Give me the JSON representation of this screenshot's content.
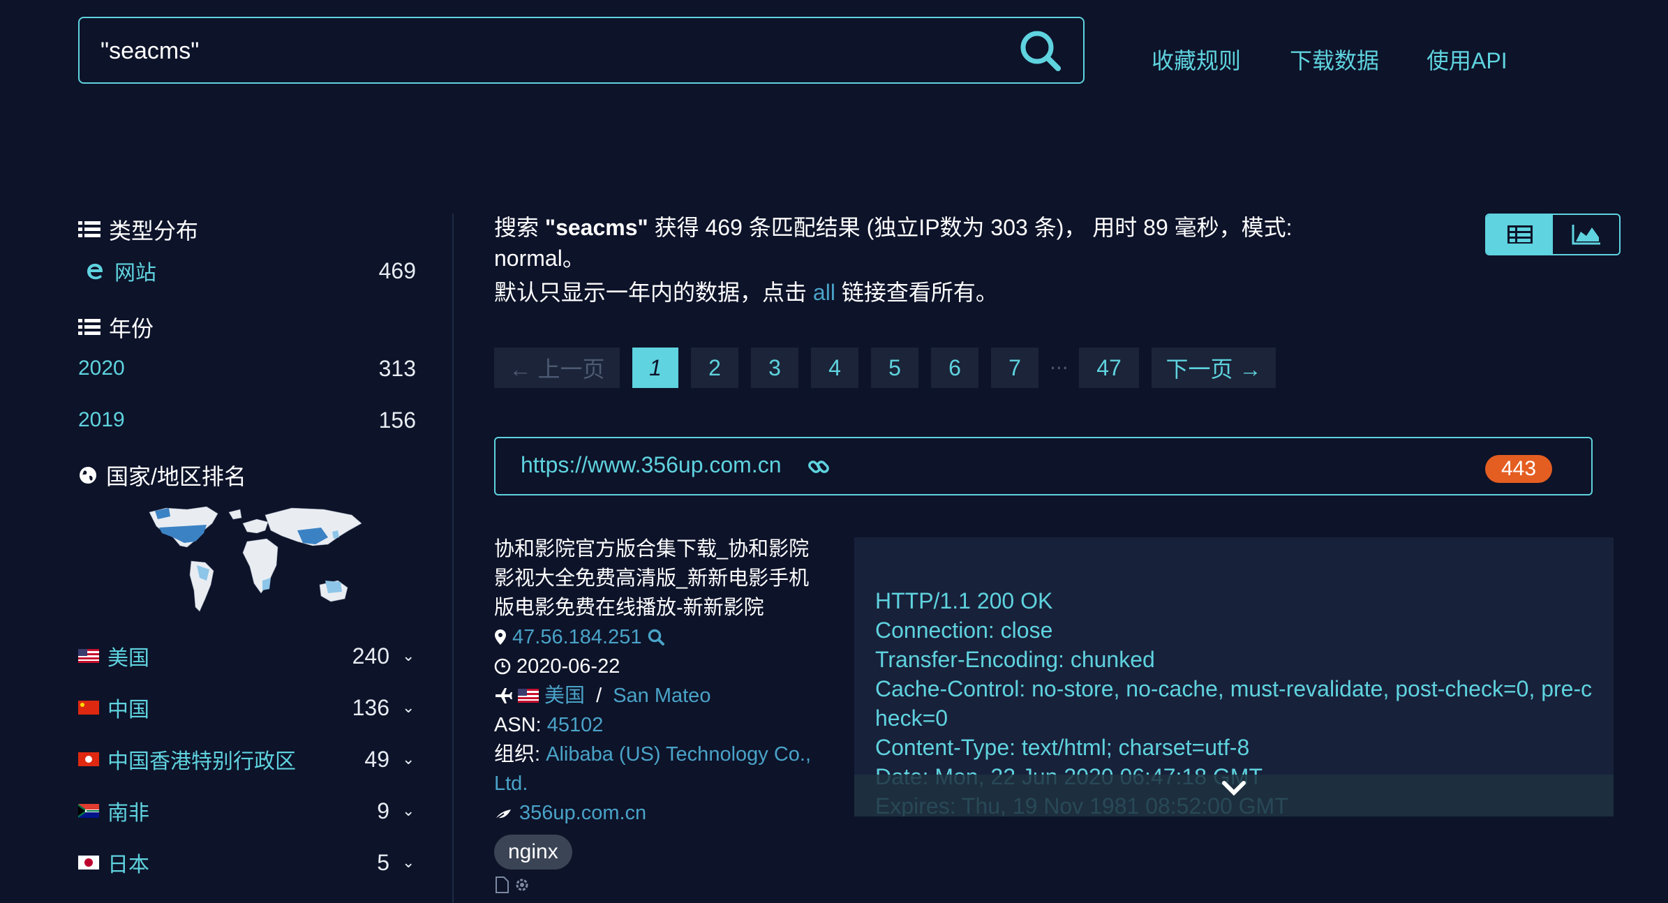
{
  "search": {
    "value": "\"seacms\""
  },
  "top_links": [
    "收藏规则",
    "下载数据",
    "使用API"
  ],
  "sidebar": {
    "type_title": "类型分布",
    "type_items": [
      {
        "label": "网站",
        "count": "469"
      }
    ],
    "year_title": "年份",
    "year_items": [
      {
        "label": "2020",
        "count": "313"
      },
      {
        "label": "2019",
        "count": "156"
      }
    ],
    "country_title": "国家/地区排名",
    "countries": [
      {
        "label": "美国",
        "count": "240"
      },
      {
        "label": "中国",
        "count": "136"
      },
      {
        "label": "中国香港特别行政区",
        "count": "49"
      },
      {
        "label": "南非",
        "count": "9"
      },
      {
        "label": "日本",
        "count": "5"
      }
    ]
  },
  "summary": {
    "p1": "搜索 ",
    "query": "\"seacms\"",
    "p2": " 获得 469 条匹配结果 (独立IP数为 303 条)， 用时 89 毫秒，模式: normal。",
    "hint_pre": "默认只显示一年内的数据，点击 ",
    "hint_link": "all",
    "hint_post": " 链接查看所有。"
  },
  "pagination": {
    "prev": "← 上一页",
    "pages": [
      "1",
      "2",
      "3",
      "4",
      "5",
      "6",
      "7"
    ],
    "ellipsis": "···",
    "last": "47",
    "next": "下一页 →"
  },
  "result": {
    "url": "https://www.356up.com.cn",
    "port": "443",
    "title": "协和影院官方版合集下载_协和影院影视大全免费高清版_新新电影手机版电影免费在线播放-新新影院",
    "ip": "47.56.184.251",
    "date": "2020-06-22",
    "country": "美国",
    "separator": " / ",
    "city": "San Mateo",
    "asn_label": "ASN: ",
    "asn": "45102",
    "org_label": "组织: ",
    "org": "Alibaba (US) Technology Co., Ltd.",
    "domain": "356up.com.cn",
    "server": "nginx",
    "headers": "HTTP/1.1 200 OK\nConnection: close\nTransfer-Encoding: chunked\nCache-Control: no-store, no-cache, must-revalidate, post-check=0, pre-check=0\nContent-Type: text/html; charset=utf-8\nDate: Mon, 22 Jun 2020 06:47:18 GMT\nExpires: Thu, 19 Nov 1981 08:52:00 GMT"
  },
  "colors": {
    "accent": "#5fd3df",
    "background": "#0d1329",
    "badge": "#e45e21",
    "link": "#4aa3c8"
  }
}
